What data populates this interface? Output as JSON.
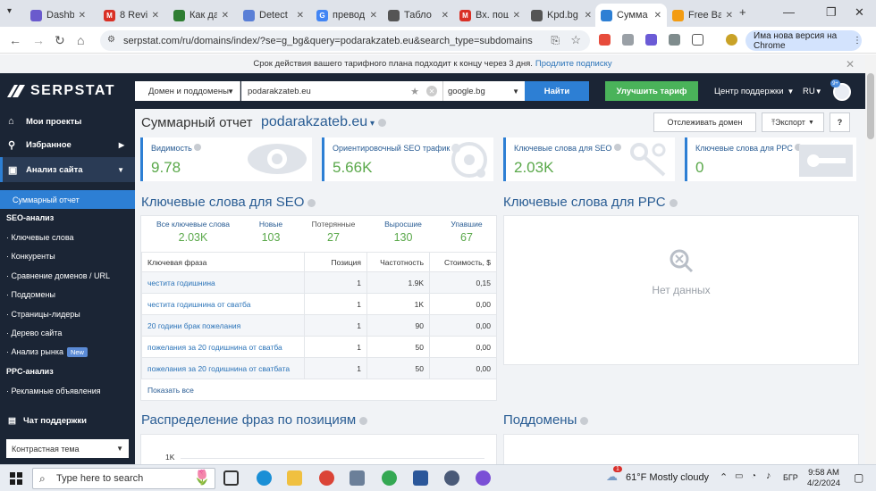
{
  "browser": {
    "tabs": [
      {
        "title": "Dashbo",
        "icon": "dashboard-icon",
        "color": "#6a5acd"
      },
      {
        "title": "8 Revis",
        "icon": "gmail-icon",
        "color": "#d93025"
      },
      {
        "title": "Как да",
        "icon": "chat-icon",
        "color": "#2e7d32"
      },
      {
        "title": "Detect",
        "icon": "detector-icon",
        "color": "#5a7fd6"
      },
      {
        "title": "превод",
        "icon": "google-icon",
        "color": "#4285f4"
      },
      {
        "title": "Табло",
        "icon": "dashboard-icon",
        "color": "#555555"
      },
      {
        "title": "Вх. пощ",
        "icon": "gmail-icon",
        "color": "#d93025"
      },
      {
        "title": "Kpd.bg",
        "icon": "web-icon",
        "color": "#555555"
      },
      {
        "title": "Сумма",
        "icon": "serpstat-icon",
        "color": "#2d7fd4"
      },
      {
        "title": "Free Ba",
        "icon": "web-icon",
        "color": "#f39c12"
      }
    ],
    "url": "serpstat.com/ru/domains/index/?se=g_bg&query=podarakzateb.eu&search_type=subdomains",
    "chrome_update": "Има нова версия на Chrome"
  },
  "notice": {
    "text": "Срок действия вашего тарифного плана подходит к концу через 3 дня.",
    "link": "Продлите подписку"
  },
  "header": {
    "logo": "SERPSTAT",
    "search_mode": "Домен и поддомены",
    "query": "podarakzateb.eu",
    "database": "google.bg",
    "find_button": "Найти",
    "upgrade_button": "Улучшить тариф",
    "support": "Центр поддержки",
    "language": "RU",
    "badge": "9+"
  },
  "sidebar": {
    "my_projects": "Мои проекты",
    "favorites": "Избранное",
    "site_analysis": "Анализ сайта",
    "summary": "Суммарный отчет",
    "seo_header": "SEO-анализ",
    "seo_items": [
      "· Ключевые слова",
      "· Конкуренты",
      "· Сравнение доменов / URL",
      "· Поддомены",
      "· Страницы-лидеры",
      "· Дерево сайта",
      "· Анализ рынка"
    ],
    "new_badge": "New",
    "ppc_header": "PPC-анализ",
    "ppc_items": [
      "· Рекламные объявления"
    ],
    "chat": "Чат поддержки",
    "theme": "Контрастная тема"
  },
  "report": {
    "title": "Суммарный отчет",
    "domain": "podarakzateb.eu",
    "track_button": "Отслеживать домен",
    "export_button": "Экспорт",
    "help_button": "?",
    "kpis": [
      {
        "label": "Видимость",
        "value": "9.78"
      },
      {
        "label": "Ориентировочный SEO трафик",
        "value": "5.66K"
      },
      {
        "label": "Ключевые слова для SEO",
        "value": "2.03K"
      },
      {
        "label": "Ключевые слова для PPC",
        "value": "0"
      }
    ],
    "seo_keywords_title": "Ключевые слова для SEO",
    "ppc_keywords_title": "Ключевые слова для PPC",
    "stats": [
      {
        "label": "Все ключевые слова",
        "value": "2.03K"
      },
      {
        "label": "Новые",
        "value": "103"
      },
      {
        "label": "Потерянные",
        "value": "27"
      },
      {
        "label": "Выросшие",
        "value": "130"
      },
      {
        "label": "Упавшие",
        "value": "67"
      }
    ],
    "table_headers": [
      "Ключевая фраза",
      "Позиция",
      "Частотность",
      "Стоимость, $"
    ],
    "rows": [
      [
        "честита годишнина",
        "1",
        "1.9K",
        "0,15"
      ],
      [
        "честита годишнина от сватба",
        "1",
        "1K",
        "0,00"
      ],
      [
        "20 години брак пожелания",
        "1",
        "90",
        "0,00"
      ],
      [
        "пожелания за 20 годишнина от сватба",
        "1",
        "50",
        "0,00"
      ],
      [
        "пожелания за 20 годишнина от сватбата",
        "1",
        "50",
        "0,00"
      ]
    ],
    "show_all": "Показать все",
    "no_data": "Нет данных",
    "positions_title": "Распределение фраз по позициям",
    "positions_tick": "1K",
    "subdomains_title": "Поддомены"
  },
  "taskbar": {
    "search_placeholder": "Type here to search",
    "temperature": "61°F",
    "weather": "Mostly cloudy",
    "weather_badge": "1",
    "input_lang": "БГР",
    "time": "9:58 AM",
    "date": "4/2/2024"
  }
}
